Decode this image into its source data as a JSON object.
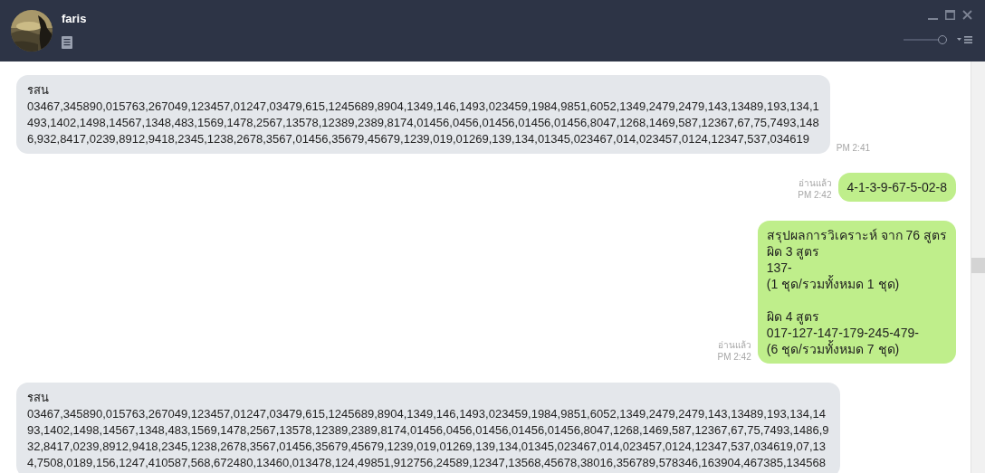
{
  "window": {
    "title": "faris"
  },
  "header": {
    "zoom_slider": {
      "level": 0.9
    }
  },
  "messages": [
    {
      "kind": "incoming",
      "sender": "รสน",
      "paragraphs": [
        [
          "03467,345890,015763,267049,123457,01247,03479,615,1245689,8904,1349,146,1493,023459,1984,9851,6052,1349,2479,2479,143,13489,193,134,1",
          "493,1402,1498,14567,1348,483,1569,1478,2567,13578,12389,2389,8174,01456,0456,01456,01456,01456,8047,1268,1469,587,12367,67,75,7493,148",
          "6,932,8417,0239,8912,9418,2345,1238,2678,3567,01456,35679,45679,1239,019,01269,139,134,01345,023467,014,023457,0124,12347,537,034619"
        ]
      ],
      "time": "PM 2:41"
    },
    {
      "kind": "outgoing",
      "read": "อ่านแล้ว",
      "time": "PM 2:42",
      "paragraphs": [
        [
          "4-1-3-9-67-5-02-8"
        ]
      ]
    },
    {
      "kind": "outgoing",
      "read": "อ่านแล้ว",
      "time": "PM 2:42",
      "paragraphs": [
        [
          "สรุปผลการวิเคราะห์ จาก 76 สูตร",
          "ผิด 3 สูตร",
          "137-",
          "(1 ชุด/รวมทั้งหมด 1 ชุด)"
        ],
        [
          "ผิด 4 สูตร",
          "017-127-147-179-245-479-",
          "(6 ชุด/รวมทั้งหมด 7 ชุด)"
        ]
      ]
    },
    {
      "kind": "incoming",
      "sender": "รสน",
      "paragraphs": [
        [
          "03467,345890,015763,267049,123457,01247,03479,615,1245689,8904,1349,146,1493,023459,1984,9851,6052,1349,2479,2479,143,13489,193,134,14",
          "93,1402,1498,14567,1348,483,1569,1478,2567,13578,12389,2389,8174,01456,0456,01456,01456,01456,8047,1268,1469,587,12367,67,75,7493,1486,9",
          "32,8417,0239,8912,9418,2345,1238,2678,3567,01456,35679,45679,1239,019,01269,139,134,01345,023467,014,023457,0124,12347,537,034619,07,13",
          "4,7508,0189,156,1247,410587,568,672480,13460,013478,124,49851,912756,24589,12347,13568,45678,38016,356789,578346,163904,467385,134568"
        ]
      ]
    }
  ]
}
